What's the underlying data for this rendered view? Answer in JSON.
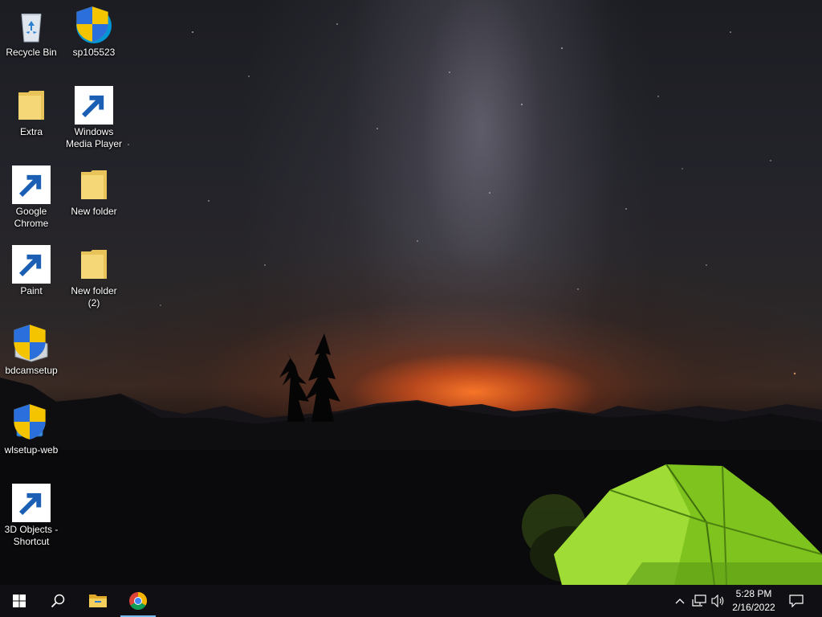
{
  "desktop": {
    "icons": [
      {
        "label": "Recycle Bin",
        "icon": "recycle-bin-icon"
      },
      {
        "label": "sp105523",
        "icon": "hp-installer-icon"
      },
      {
        "label": "Extra",
        "icon": "folder-icon"
      },
      {
        "label": "Windows Media Player",
        "icon": "windows-media-player-icon"
      },
      {
        "label": "Google Chrome",
        "icon": "chrome-icon"
      },
      {
        "label": "New folder",
        "icon": "folder-icon"
      },
      {
        "label": "Paint",
        "icon": "paint-icon"
      },
      {
        "label": "New folder (2)",
        "icon": "folder-icon"
      },
      {
        "label": "bdcamsetup",
        "icon": "bandicam-setup-icon"
      },
      {
        "label": "wlsetup-web",
        "icon": "windows-live-setup-icon"
      },
      {
        "label": "3D Objects - Shortcut",
        "icon": "3d-objects-icon"
      }
    ]
  },
  "taskbar": {
    "start": "windows-start-icon",
    "search": "search-icon",
    "pinned": [
      {
        "name": "file-explorer",
        "icon": "folder-icon",
        "active": false
      },
      {
        "name": "google-chrome",
        "icon": "chrome-icon",
        "active": true
      }
    ],
    "tray": {
      "icons": [
        "chevron-up-icon",
        "network-icon",
        "volume-icon"
      ],
      "time": "5:28 PM",
      "date": "2/16/2022",
      "notification_icon": "action-center-icon"
    },
    "accent": "#76b9ed"
  }
}
